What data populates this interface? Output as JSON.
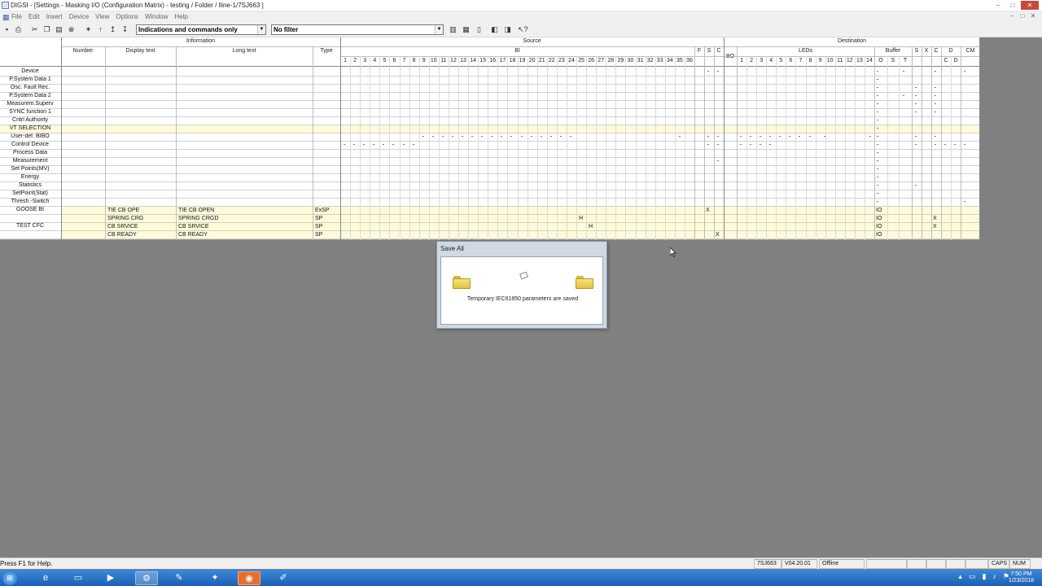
{
  "window": {
    "title": "DIGSI - [Settings - Masking I/O (Configuration Matrix) - testing / Folder / lline-1/7SJ663 ]",
    "controls": [
      "–",
      "□",
      "✕"
    ]
  },
  "menu": [
    "File",
    "Edit",
    "Insert",
    "Device",
    "View",
    "Options",
    "Window",
    "Help"
  ],
  "toolbar": {
    "view_filter": "Indications and commands only",
    "info_filter": "No filter",
    "icons": [
      "save-icon",
      "print-icon",
      "cut-icon",
      "copy-icon",
      "paste-icon",
      "delete-icon",
      "insert-icon",
      "up-icon",
      "down-icon",
      "sort-icon"
    ]
  },
  "matrix": {
    "group_headers": {
      "information": "Information",
      "source": "Source",
      "destination": "Destination"
    },
    "columns": {
      "number": "Number",
      "display_text": "Display text",
      "long_text": "Long text",
      "type": "Type"
    },
    "source_subheaders": {
      "bi": "BI",
      "f": "F",
      "s": "S",
      "c": "C"
    },
    "destination_subheaders": {
      "bo": "BO",
      "leds": "LEDs",
      "buffer": "Buffer",
      "s": "S",
      "x": "X",
      "c": "C",
      "d": "D",
      "cm": "CM"
    },
    "buffer_cols": [
      "O",
      "S",
      "T"
    ],
    "d_cols": [
      "C",
      "D"
    ],
    "bi_numbers": [
      "1",
      "2",
      "3",
      "4",
      "5",
      "6",
      "7",
      "8",
      "9",
      "10",
      "11",
      "12",
      "13",
      "14",
      "15",
      "16",
      "17",
      "18",
      "19",
      "20",
      "21",
      "22",
      "23",
      "24",
      "25",
      "26",
      "27",
      "28",
      "29",
      "30",
      "31",
      "32",
      "33",
      "34",
      "35",
      "36"
    ],
    "led_numbers": [
      "1",
      "2",
      "3",
      "4",
      "5",
      "6",
      "7",
      "8",
      "9",
      "10",
      "11",
      "12",
      "13",
      "14"
    ],
    "groups": [
      "Device",
      "P.System Data 1",
      "Osc. Fault Rec.",
      "P.System Data 2",
      "Measurem.Superv",
      "SYNC function 1",
      "Cntrl Authority",
      "VT SELECTION",
      "User-def. BIBO",
      "Control Device",
      "Process Data",
      "Measurement",
      "Set Points(MV)",
      "Energy",
      "Statistics",
      "SetPoint(Stat)",
      "Thresh.-Switch",
      "GOOSE BI",
      "TEST CFC"
    ],
    "rows": [
      {
        "display": "TIE CB OPE",
        "long": "TIE CB OPEN",
        "type": "ExSP",
        "mark1": "X",
        "buffer": "IO"
      },
      {
        "display": "SPRING CRG",
        "long": "SPRING CRGD",
        "type": "SP",
        "mark1": "H",
        "buffer": "IO",
        "mark2": "X"
      },
      {
        "display": "CB SRVICE",
        "long": "CB SRVICE",
        "type": "SP",
        "mark1": "H",
        "buffer": "IO",
        "mark2": "X"
      },
      {
        "display": "CB READY",
        "long": "CB READY",
        "type": "SP",
        "mark1": "X",
        "buffer": "IO"
      }
    ]
  },
  "dialog": {
    "title": "Save All",
    "message": "Temporary IEC61850 parameters are saved"
  },
  "statusbar": {
    "help": "Press F1 for Help.",
    "device": "7SJ663",
    "version": "V04.20.01",
    "mode": "Offline",
    "caps": "CAPS",
    "num": "NUM"
  },
  "taskbar": {
    "time": "7:50 PM",
    "date": "1/23/2018"
  }
}
